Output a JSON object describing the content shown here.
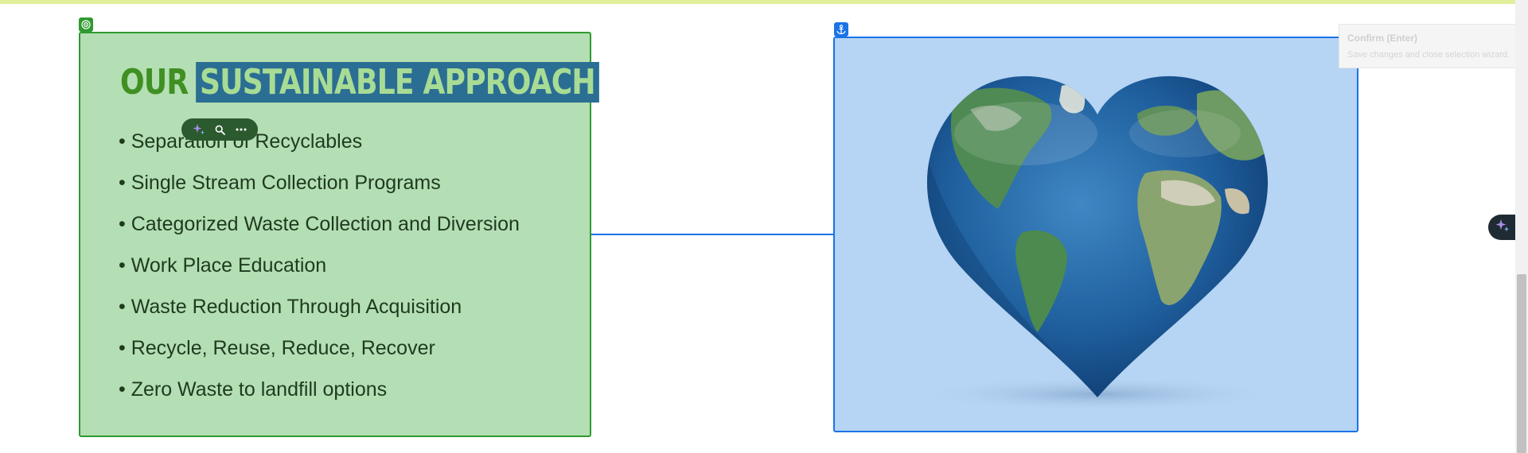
{
  "text_block": {
    "heading_word_1": "OUR",
    "heading_word_2": "SUSTAINABLE APPROACH",
    "bullets": [
      "• Separation of Recyclables",
      "• Single Stream Collection Programs",
      "• Categorized Waste Collection and Diversion",
      "• Work Place Education",
      "• Waste Reduction Through Acquisition",
      "• Recycle, Reuse, Reduce, Recover",
      "• Zero Waste to landfill options"
    ],
    "badge_icon": "target-icon"
  },
  "inline_toolbar": {
    "icons": [
      "sparkle-icon",
      "search-icon",
      "more-icon"
    ]
  },
  "image_block": {
    "image": "heart-shaped-earth-globe",
    "badge_icon": "anchor-icon"
  },
  "tooltip": {
    "title": "Confirm (Enter)",
    "description": "Save changes and close selection wizard."
  },
  "ai_button_icon": "sparkle-icon",
  "colors": {
    "text_block_bg": "#b4deb3",
    "text_block_border": "#2f9a2f",
    "heading_green": "#3f8f22",
    "selection_bg": "#2b6e93",
    "image_selection": "#1a73e8",
    "top_strip": "#e1ee9a"
  }
}
